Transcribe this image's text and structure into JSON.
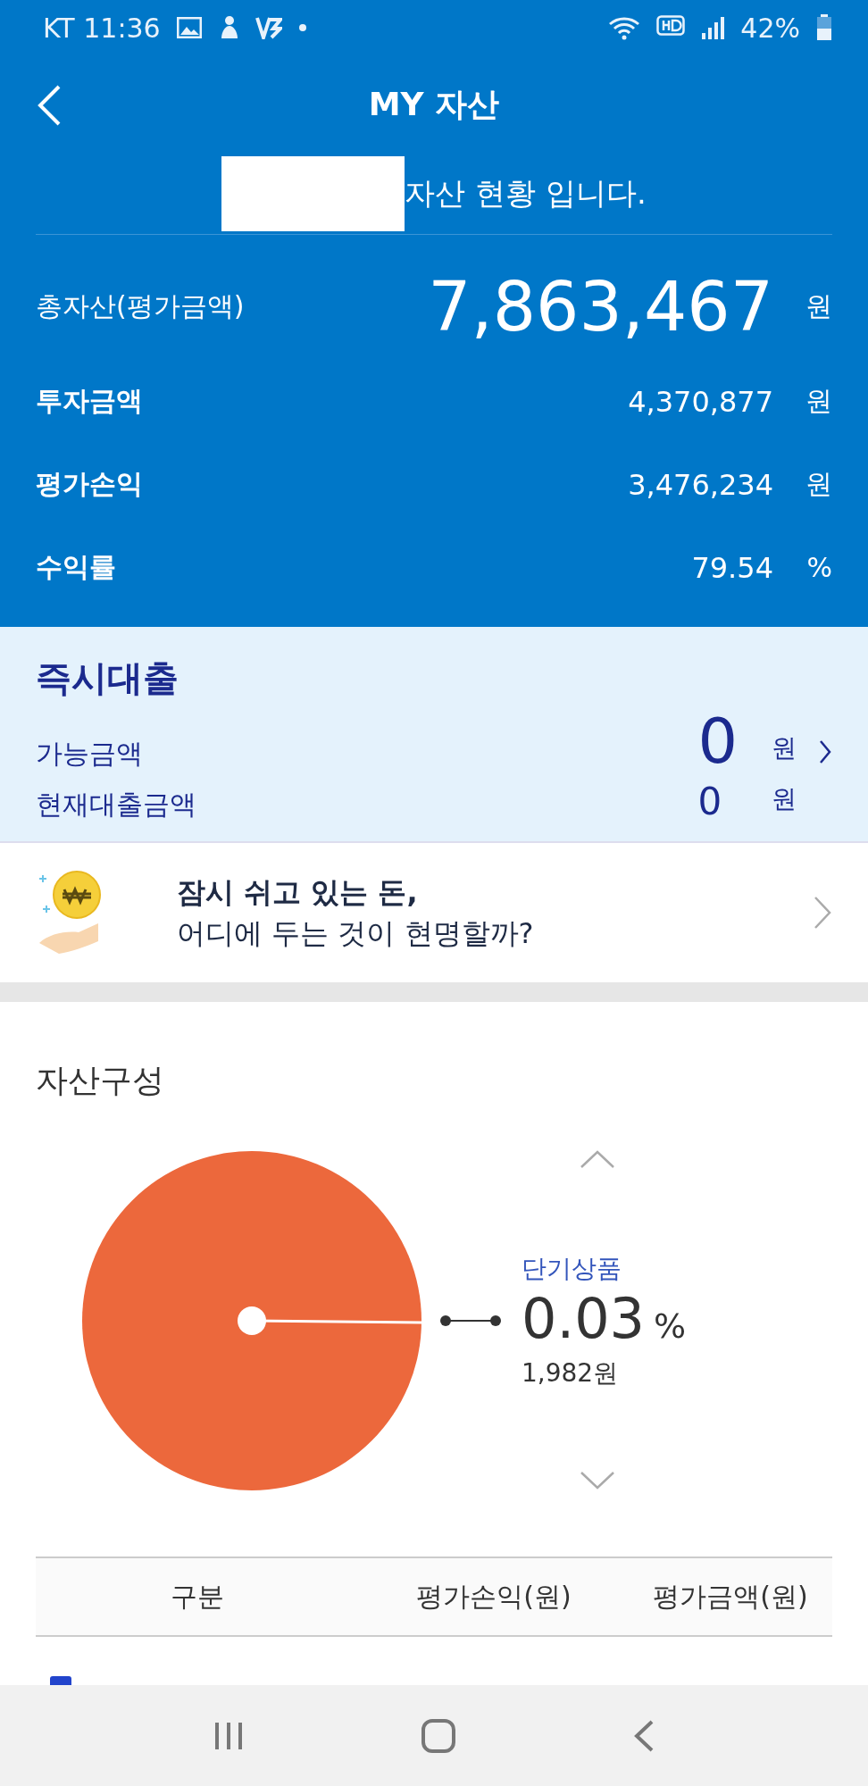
{
  "status_bar": {
    "carrier_time": "KT 11:36",
    "battery": "42%"
  },
  "header": {
    "title": "MY 자산",
    "subtitle": "자산 현황 입니다."
  },
  "summary": {
    "total": {
      "label": "총자산(평가금액)",
      "value": "7,863,467",
      "unit": "원"
    },
    "rows": [
      {
        "label": "투자금액",
        "value": "4,370,877",
        "unit": "원"
      },
      {
        "label": "평가손익",
        "value": "3,476,234",
        "unit": "원"
      },
      {
        "label": "수익률",
        "value": "79.54",
        "unit": "%"
      }
    ]
  },
  "loan": {
    "title": "즉시대출",
    "available_label": "가능금액",
    "available_value": "0",
    "available_unit": "원",
    "current_label": "현재대출금액",
    "current_value": "0",
    "current_unit": "원"
  },
  "banner": {
    "line1": "잠시 쉬고 있는 돈,",
    "line2": "어디에 두는 것이 현명할까?"
  },
  "composition": {
    "title": "자산구성",
    "legend": {
      "name": "단기상품",
      "percent": "0.03",
      "percent_unit": "%",
      "amount": "1,982원"
    }
  },
  "table": {
    "columns": [
      "구분",
      "평가손익(원)",
      "평가금액(원)"
    ],
    "rows": [
      {
        "color": "#2244cc"
      }
    ]
  }
}
